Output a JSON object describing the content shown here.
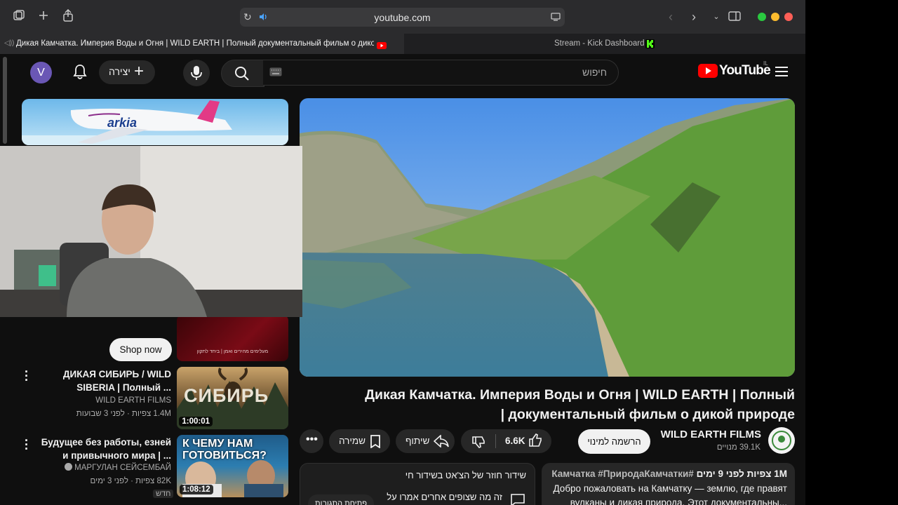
{
  "browser": {
    "url": "youtube.com",
    "tabs": [
      {
        "title": "Дикая Камчатка. Империя Воды и Огня | WILD EARTH | Полный документальный фильм о дикой пр..."
      },
      {
        "title": "Stream - Kick Dashboard"
      }
    ]
  },
  "header": {
    "search_placeholder": "חיפוש",
    "create_label": "יצירה",
    "avatar_letter": "V",
    "logo_text": "YouTube",
    "logo_region": "IL"
  },
  "video": {
    "title": "Дикая Камчатка. Империя Воды и Огня | WILD EARTH | Полный документальный фильм о дикой природе |",
    "channel_name": "WILD EARTH FILMS",
    "subscribers": "39.1K מנויים",
    "subscribe_label": "הרשמה למינוי",
    "likes": "6.6K",
    "share_label": "שיתוף",
    "save_label": "שמירה"
  },
  "description": {
    "stats": "1M צפיות  לפני 9 ימים",
    "hashtags": "#Камчатка #ПриродаКамчатки",
    "line1": "Добро пожаловать на Камчатку — землю, где правят",
    "line2": "вулканы и дикая природа. Этот документальны..."
  },
  "chat": {
    "title": "שידור חוזר של הצ'אט בשידור חי",
    "subtitle": "זה מה שצופים אחרים אמרו על",
    "open_button": "פתיחת התגובות"
  },
  "sidebar": {
    "ad": {
      "brand": "arkia",
      "shop_label": "Shop now",
      "banner_text": "מעלימים מהירים ואמן | ביחד לתקון"
    },
    "videos": [
      {
        "title": "ДИКАЯ СИБИРЬ / WILD SIBERIA | Полный ...",
        "channel": "WILD EARTH FILMS",
        "meta": "1.4M צפיות · לפני 3 שבועות",
        "duration": "1:00:01",
        "thumb_text": "СИБИРЬ"
      },
      {
        "title": "Будущее без работы, езней и привычного мира | ...",
        "channel": "МАРГУЛАН СЕЙСЕМБАЙ",
        "meta": "82K צפיות · לפני 3 ימים",
        "badge": "חדש",
        "duration": "1:08:12",
        "thumb_text": "К ЧЕМУ НАМ ГОТОВИТЬСЯ?"
      }
    ]
  },
  "colors": {
    "youtube_red": "#ff0000",
    "kick_green": "#53fc18",
    "bg": "#0f0f0f"
  }
}
